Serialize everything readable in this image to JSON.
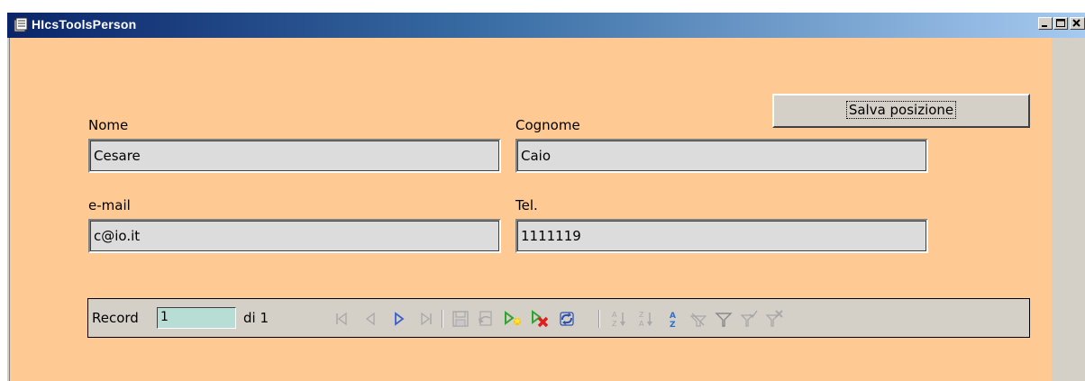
{
  "window": {
    "title": "HIcsToolsPerson"
  },
  "form": {
    "save_button_label": "Salva posizione",
    "nome_label": "Nome",
    "nome_value": "Cesare",
    "cognome_label": "Cognome",
    "cognome_value": "Caio",
    "email_label": "e-mail",
    "email_value": "c@io.it",
    "tel_label": "Tel.",
    "tel_value": "1111119"
  },
  "navigator": {
    "record_label": "Record",
    "current_record": "1",
    "of_label": "di 1"
  },
  "icons": [
    "first-record-icon",
    "previous-record-icon",
    "next-record-icon",
    "last-record-icon",
    "save-record-icon",
    "undo-record-icon",
    "new-record-icon",
    "delete-record-icon",
    "refresh-icon",
    "sort-ascending-icon",
    "sort-descending-icon",
    "sort-az-icon",
    "filter-by-form-icon",
    "filter-icon",
    "apply-filter-icon",
    "remove-filter-icon"
  ]
}
